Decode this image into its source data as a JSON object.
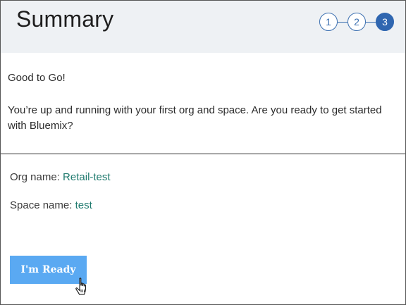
{
  "header": {
    "title": "Summary",
    "steps": [
      "1",
      "2",
      "3"
    ],
    "active_step": "3"
  },
  "intro": {
    "status": "Good to Go!",
    "message": "You’re up and running with your first org and space. Are you ready to get started with Bluemix?"
  },
  "details": {
    "org_label": "Org name:",
    "org_value": "Retail-test",
    "space_label": "Space name:",
    "space_value": "test"
  },
  "actions": {
    "ready_label": "I'm Ready"
  },
  "colors": {
    "accent": "#2f66b0",
    "value_text": "#1f7a6e",
    "button": "#5aa9f2",
    "header_bg": "#eef1f4"
  },
  "icons": {
    "cursor": "hand-pointer-icon"
  }
}
